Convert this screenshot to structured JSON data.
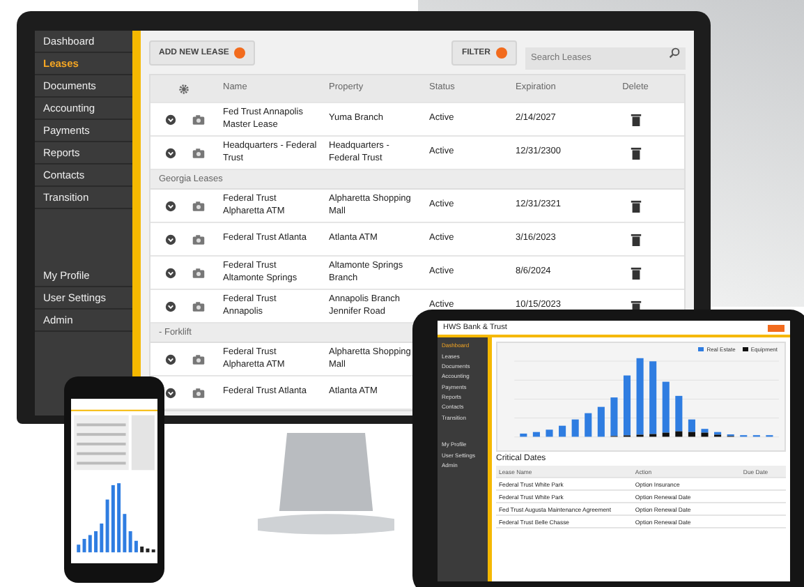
{
  "monitor": {
    "sidebar": {
      "main": [
        {
          "label": "Dashboard",
          "selected": false
        },
        {
          "label": "Leases",
          "selected": true
        },
        {
          "label": "Documents",
          "selected": false
        },
        {
          "label": "Accounting",
          "selected": false
        },
        {
          "label": "Payments",
          "selected": false
        },
        {
          "label": "Reports",
          "selected": false
        },
        {
          "label": "Contacts",
          "selected": false
        },
        {
          "label": "Transition",
          "selected": false
        }
      ],
      "account": [
        {
          "label": "My Profile",
          "selected": false
        },
        {
          "label": "User Settings",
          "selected": false
        },
        {
          "label": "Admin",
          "selected": false
        }
      ]
    },
    "add_button": "ADD NEW LEASE",
    "filter_button": "FILTER",
    "search": {
      "placeholder": "Search Leases"
    },
    "table": {
      "columns": [
        "Name",
        "Property",
        "Status",
        "Expiration",
        "Delete"
      ],
      "groups": [
        {
          "rows": [
            {
              "name": "Fed Trust Annapolis Master Lease",
              "property": "Yuma Branch",
              "status": "Active",
              "expiration": "2/14/2027"
            },
            {
              "name": "Headquarters - Federal Trust",
              "property": "Headquarters - Federal Trust",
              "status": "Active",
              "expiration": "12/31/2300"
            }
          ]
        },
        {
          "label": "Georgia Leases",
          "rows": [
            {
              "name": "Federal Trust Alpharetta ATM",
              "property": "Alpharetta Shopping Mall",
              "status": "Active",
              "expiration": "12/31/2321"
            },
            {
              "name": "Federal Trust Atlanta",
              "property": "Atlanta ATM",
              "status": "Active",
              "expiration": "3/16/2023"
            },
            {
              "name": "Federal Trust Altamonte Springs",
              "property": "Altamonte Springs Branch",
              "status": "Active",
              "expiration": "8/6/2024"
            },
            {
              "name": "Federal Trust Annapolis",
              "property": "Annapolis Branch Jennifer Road",
              "status": "Active",
              "expiration": "10/15/2023"
            }
          ]
        },
        {
          "label": "- Forklift",
          "rows": [
            {
              "name": "Federal Trust Alpharetta ATM",
              "property": "Alpharetta Shopping Mall"
            },
            {
              "name": "Federal Trust Atlanta",
              "property": "Atlanta ATM"
            }
          ]
        }
      ]
    }
  },
  "tablet": {
    "title": "HWS Bank & Trust",
    "sidebar": {
      "main": [
        {
          "label": "Dashboard",
          "selected": true
        },
        {
          "label": "Leases",
          "selected": false
        },
        {
          "label": "Documents",
          "selected": false
        },
        {
          "label": "Accounting",
          "selected": false
        },
        {
          "label": "Payments",
          "selected": false
        },
        {
          "label": "Reports",
          "selected": false
        },
        {
          "label": "Contacts",
          "selected": false
        },
        {
          "label": "Transition",
          "selected": false
        }
      ],
      "account": [
        {
          "label": "My Profile",
          "selected": false
        },
        {
          "label": "User Settings",
          "selected": false
        },
        {
          "label": "Admin",
          "selected": false
        }
      ]
    },
    "legend": [
      {
        "label": "Real Estate",
        "color": "#2f7de1"
      },
      {
        "label": "Equipment",
        "color": "#111111"
      }
    ],
    "critical_dates": {
      "title": "Critical Dates",
      "columns": [
        "Lease Name",
        "Action",
        "Due Date"
      ],
      "rows": [
        {
          "lease": "Federal Trust White Park",
          "action": "Option Insurance"
        },
        {
          "lease": "Federal Trust White Park",
          "action": "Option Renewal Date"
        },
        {
          "lease": "Fed Trust Augusta Maintenance Agreement",
          "action": "Option Renewal Date"
        },
        {
          "lease": "Federal Trust Belle Chasse",
          "action": "Option Renewal Date"
        }
      ]
    }
  }
}
